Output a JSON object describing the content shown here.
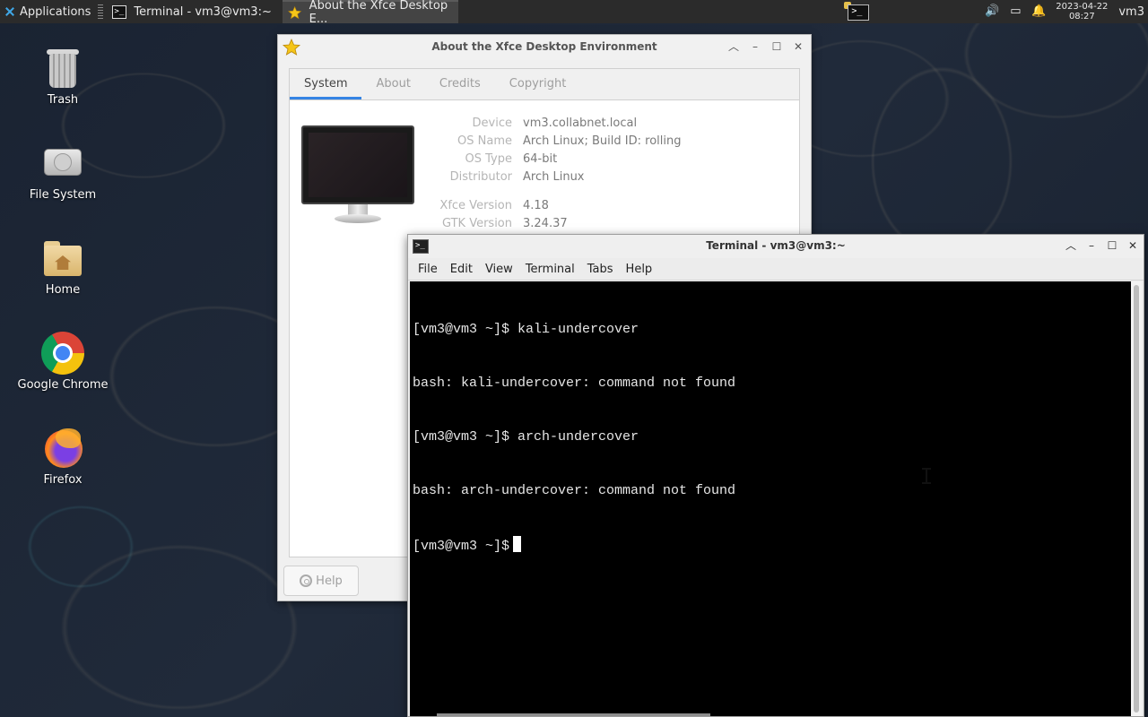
{
  "panel": {
    "applications_label": "Applications",
    "tasks": [
      {
        "label": "Terminal - vm3@vm3:~"
      },
      {
        "label": "About the Xfce Desktop E..."
      }
    ],
    "clock_date": "2023-04-22",
    "clock_time": "08:27",
    "user": "vm3"
  },
  "desktop": {
    "icons": [
      {
        "label": "Trash",
        "icon": "trash-icon"
      },
      {
        "label": "File System",
        "icon": "drive-icon"
      },
      {
        "label": "Home",
        "icon": "home-folder-icon"
      },
      {
        "label": "Google Chrome",
        "icon": "chrome-icon"
      },
      {
        "label": "Firefox",
        "icon": "firefox-icon"
      }
    ]
  },
  "about": {
    "title": "About the Xfce Desktop Environment",
    "tabs": [
      "System",
      "About",
      "Credits",
      "Copyright"
    ],
    "active_tab": "System",
    "info": [
      {
        "key": "Device",
        "value": "vm3.collabnet.local"
      },
      {
        "key": "OS Name",
        "value": "Arch Linux; Build ID: rolling"
      },
      {
        "key": "OS Type",
        "value": "64-bit"
      },
      {
        "key": "Distributor",
        "value": "Arch Linux"
      }
    ],
    "versions": [
      {
        "key": "Xfce Version",
        "value": "4.18"
      },
      {
        "key": "GTK Version",
        "value": "3.24.37"
      }
    ],
    "help_label": "Help"
  },
  "terminal": {
    "title": "Terminal - vm3@vm3:~",
    "menu": [
      "File",
      "Edit",
      "View",
      "Terminal",
      "Tabs",
      "Help"
    ],
    "lines": [
      "[vm3@vm3 ~]$ kali-undercover",
      "bash: kali-undercover: command not found",
      "[vm3@vm3 ~]$ arch-undercover",
      "bash: arch-undercover: command not found",
      "[vm3@vm3 ~]$"
    ]
  },
  "colors": {
    "panel_bg": "#2b2b2b",
    "accent": "#3584e4",
    "terminal_bg": "#000000"
  }
}
